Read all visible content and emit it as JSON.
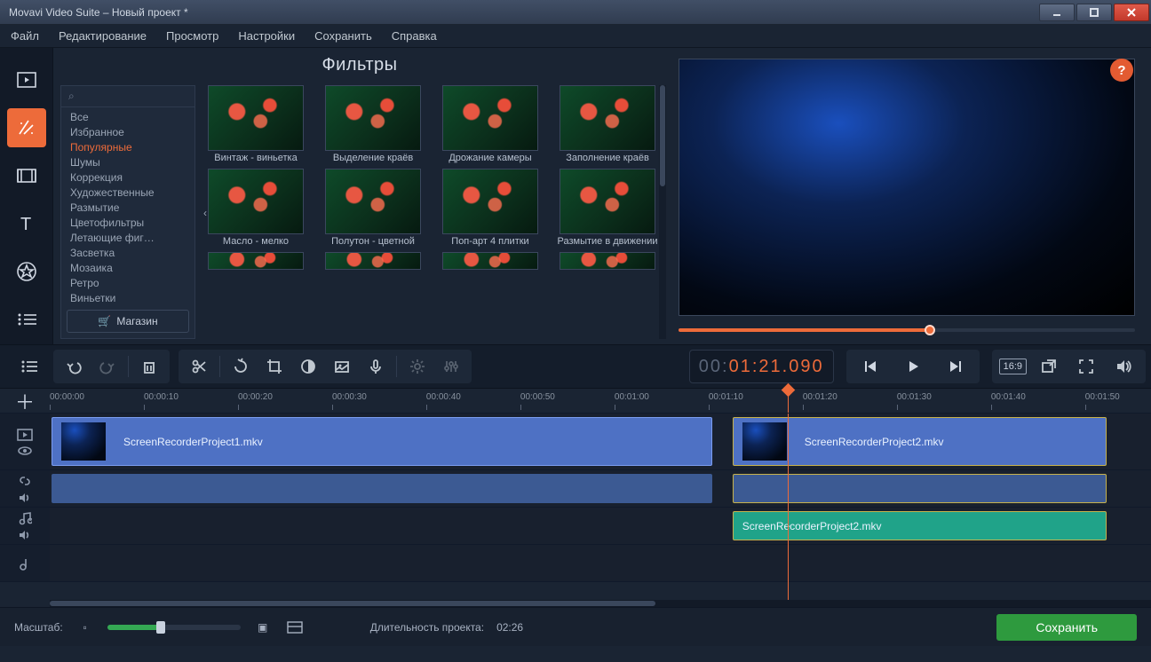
{
  "window": {
    "title": "Movavi Video Suite – Новый проект *"
  },
  "menubar": [
    "Файл",
    "Редактирование",
    "Просмотр",
    "Настройки",
    "Сохранить",
    "Справка"
  ],
  "filters": {
    "title": "Фильтры",
    "search_placeholder": "",
    "categories": [
      "Все",
      "Избранное",
      "Популярные",
      "Шумы",
      "Коррекция",
      "Художественные",
      "Размытие",
      "Цветофильтры",
      "Летающие фиг…",
      "Засветка",
      "Мозаика",
      "Ретро",
      "Виньетки"
    ],
    "active_category_index": 2,
    "shop_label": "Магазин",
    "items_row1": [
      "Винтаж - виньетка",
      "Выделение краёв",
      "Дрожание камеры",
      "Заполнение краёв"
    ],
    "items_row2": [
      "Масло - мелко",
      "Полутон - цветной",
      "Поп-арт 4 плитки",
      "Размытие в движении"
    ]
  },
  "transport": {
    "timecode_hours": "00",
    "timecode_rest": "01:21.090",
    "aspect_ratio": "16:9"
  },
  "ruler": {
    "ticks": [
      "00:00:00",
      "00:00:10",
      "00:00:20",
      "00:00:30",
      "00:00:40",
      "00:00:50",
      "00:01:00",
      "00:01:10",
      "00:01:20",
      "00:01:30",
      "00:01:40",
      "00:01:50"
    ]
  },
  "clips": {
    "video1": "ScreenRecorderProject1.mkv",
    "video2": "ScreenRecorderProject2.mkv",
    "audio2": "ScreenRecorderProject2.mkv"
  },
  "footer": {
    "zoom_label": "Масштаб:",
    "duration_label": "Длительность проекта:",
    "duration_value": "02:26",
    "save_label": "Сохранить"
  }
}
